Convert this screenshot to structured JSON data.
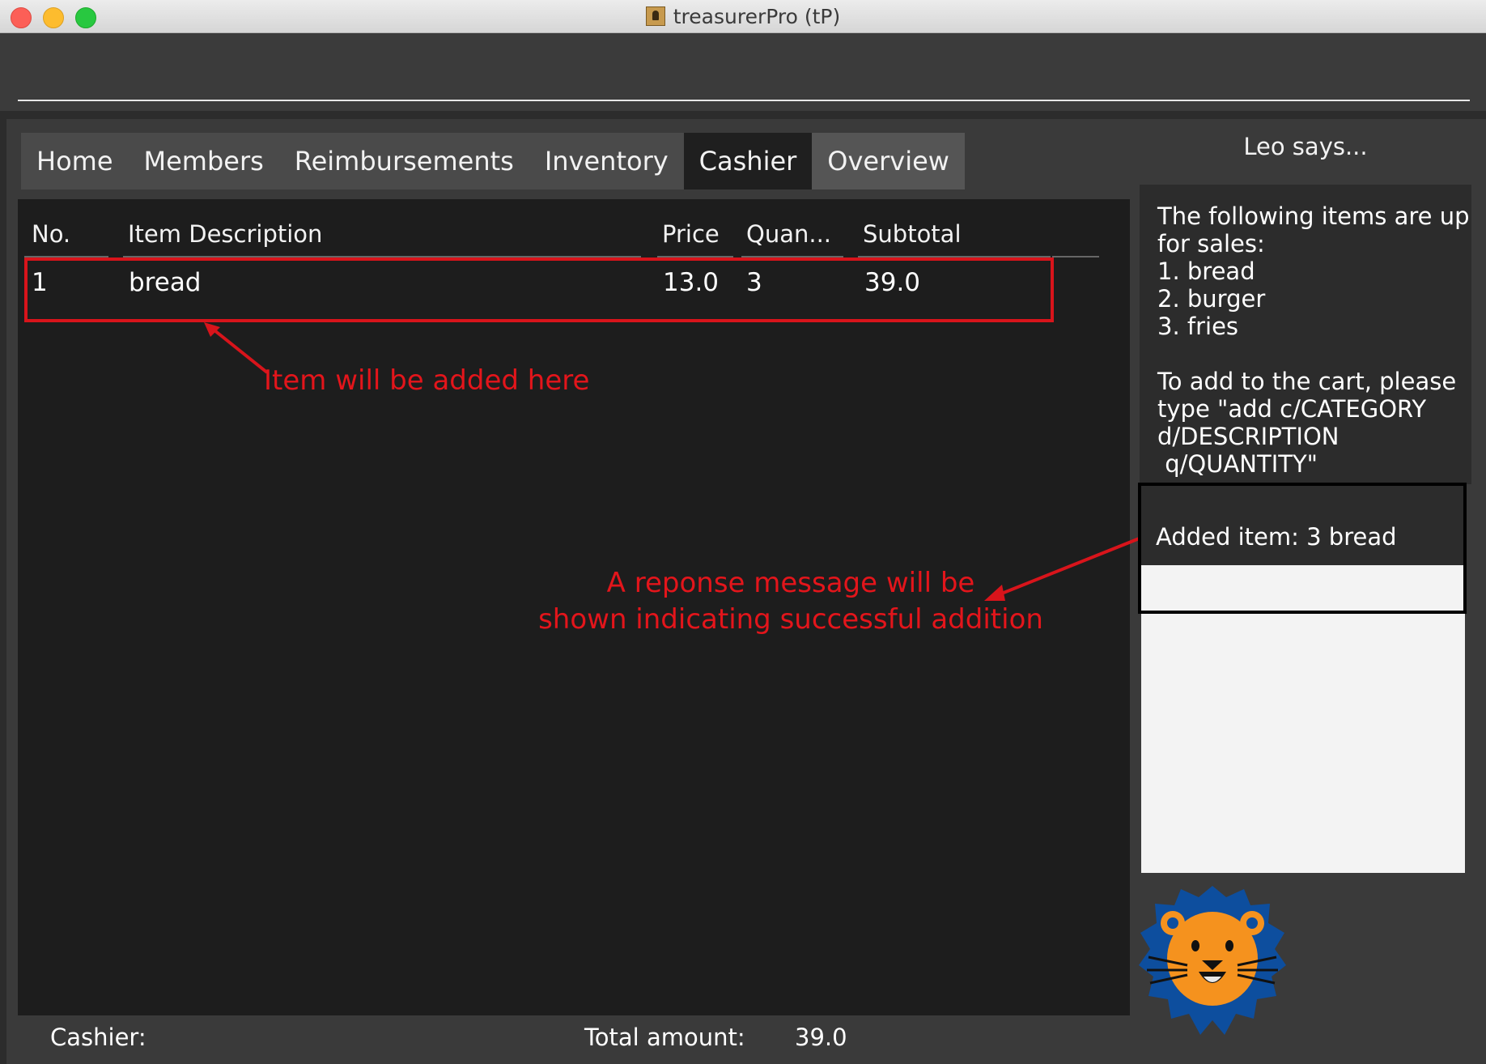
{
  "window": {
    "title": "treasurerPro (tP)"
  },
  "tabs": [
    "Home",
    "Members",
    "Reimbursements",
    "Inventory",
    "Cashier",
    "Overview"
  ],
  "table": {
    "columns": [
      "No.",
      "Item Description",
      "Price",
      "Quan...",
      "Subtotal"
    ],
    "rows": [
      {
        "no": "1",
        "description": "bread",
        "price": "13.0",
        "quantity": "3",
        "subtotal": "39.0"
      }
    ]
  },
  "annotations": {
    "row_note": "Item will be added here",
    "response_note_line1": "A reponse message will be",
    "response_note_line2": "shown indicating successful addition",
    "color": "#e3151b"
  },
  "sidebar": {
    "header": "Leo says...",
    "message_lines": [
      "The following items are up",
      "for sales:",
      "1. bread",
      "2. burger",
      "3. fries",
      "",
      "To add to the cart, please",
      "type \"add c/CATEGORY",
      "d/DESCRIPTION",
      " q/QUANTITY\""
    ],
    "result": "Added item: 3 bread"
  },
  "status_bar": {
    "cashier_label": "Cashier:",
    "total_label": "Total amount:",
    "total_value": "39.0"
  },
  "icons": {
    "mascot": "lion-mascot-icon",
    "app": "app-icon"
  }
}
